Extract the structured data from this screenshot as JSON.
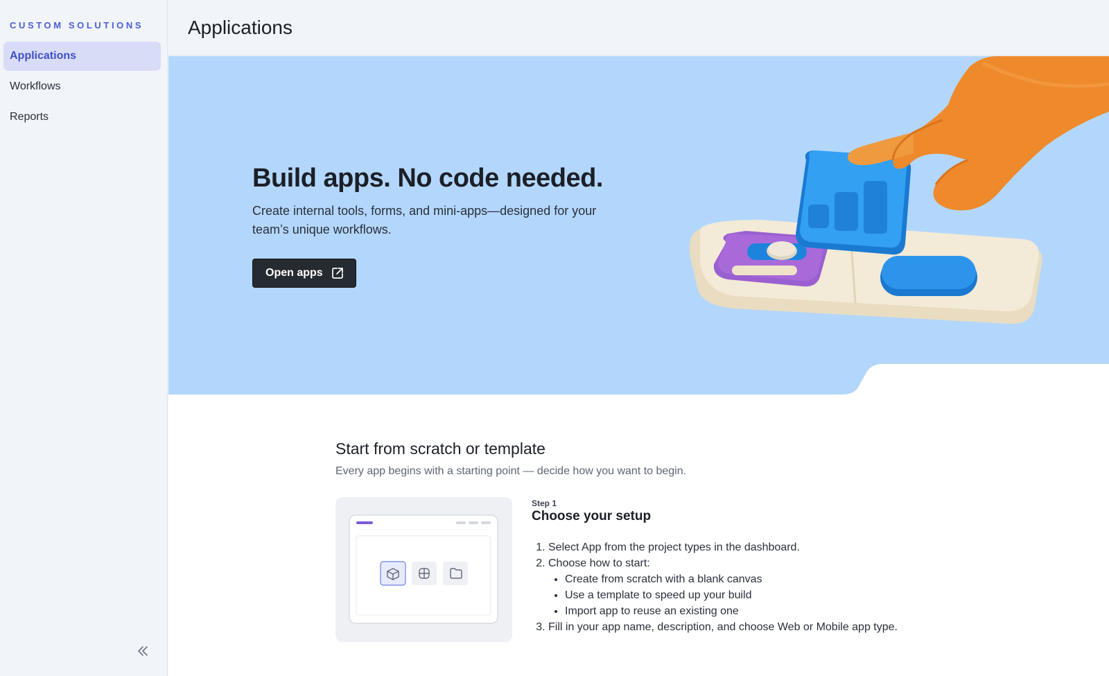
{
  "sidebar": {
    "brand": "CUSTOM SOLUTIONS",
    "items": [
      {
        "label": "Applications",
        "active": true
      },
      {
        "label": "Workflows",
        "active": false
      },
      {
        "label": "Reports",
        "active": false
      }
    ],
    "collapse_icon": "double-chevron-left-icon"
  },
  "header": {
    "title": "Applications"
  },
  "hero": {
    "title": "Build apps. No code needed.",
    "description": "Create internal tools, forms, and mini-apps—designed for your team’s unique workflows.",
    "button_label": "Open apps",
    "button_icon": "external-link-icon",
    "illustration": "hand-placing-app-block-illustration"
  },
  "section": {
    "title": "Start from scratch or template",
    "subtitle": "Every app begins with a starting point — decide how you want to begin.",
    "step": {
      "label": "Step 1",
      "title": "Choose your setup",
      "items": [
        "Select App from the project types in the dashboard.",
        "Choose how to start:",
        "Fill in your app name, description, and choose Web or Mobile app type."
      ],
      "subitems": [
        "Create from scratch with a blank canvas",
        "Use a template to speed up your build",
        "Import app to reuse an existing one"
      ]
    }
  },
  "colors": {
    "accent": "#4a5fd6",
    "hero_bg": "#b3d7fc",
    "button_bg": "#262a31"
  }
}
